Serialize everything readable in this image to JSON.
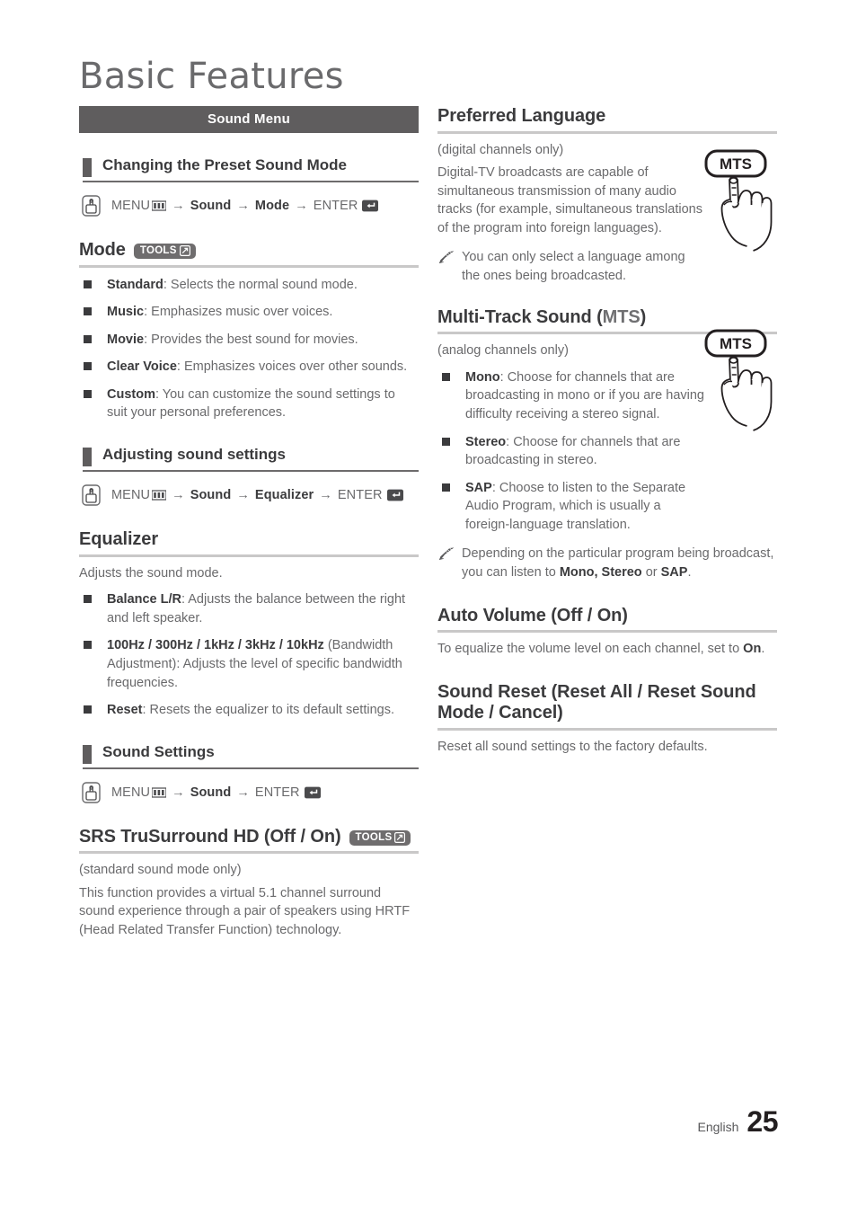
{
  "page": {
    "masthead": "Basic Features",
    "footer_language": "English",
    "footer_page_number": "25",
    "accent_bar_color": "#5f5d5e",
    "rule_color": "#c9c8c8",
    "body_text_color": "#6a6a6c",
    "heading_text_color": "#3b3b3d"
  },
  "left_column": {
    "section_bar": "Sound Menu",
    "sections": [
      {
        "subheading": "Changing the Preset Sound Mode",
        "menu_path": {
          "icon": "press-hand-icon",
          "items": [
            "MENU",
            "Sound",
            "Mode",
            "ENTER"
          ],
          "menu_icon": "menu-bars-icon",
          "enter_icon": "enter-return-icon",
          "arrow": "→"
        },
        "topic": {
          "title": "Mode",
          "badge": "TOOLS",
          "badge_icon": "tools-arrow-icon",
          "bullets": [
            {
              "term": "Standard",
              "desc": ": Selects the normal sound mode."
            },
            {
              "term": "Music",
              "desc": ": Emphasizes music over voices."
            },
            {
              "term": "Movie",
              "desc": ": Provides the best sound for movies."
            },
            {
              "term": "Clear Voice",
              "desc": ": Emphasizes voices over other sounds."
            },
            {
              "term": "Custom",
              "desc": ": You can customize the sound settings to suit your personal preferences."
            }
          ]
        }
      },
      {
        "subheading": "Adjusting sound settings",
        "menu_path": {
          "icon": "press-hand-icon",
          "items": [
            "MENU",
            "Sound",
            "Equalizer",
            "ENTER"
          ],
          "menu_icon": "menu-bars-icon",
          "enter_icon": "enter-return-icon",
          "arrow": "→"
        },
        "topic": {
          "title": "Equalizer",
          "intro": "Adjusts the sound mode.",
          "bullets": [
            {
              "term": "Balance L/R",
              "desc": ": Adjusts the balance between the right and left speaker."
            },
            {
              "term": "100Hz / 300Hz / 1kHz / 3kHz / 10kHz",
              "desc": " (Bandwidth Adjustment): Adjusts the level of specific bandwidth frequencies."
            },
            {
              "term": "Reset",
              "desc": ": Resets the equalizer to its default settings."
            }
          ]
        }
      },
      {
        "subheading": "Sound Settings",
        "menu_path": {
          "icon": "press-hand-icon",
          "items": [
            "MENU",
            "Sound",
            "ENTER"
          ],
          "menu_icon": "menu-bars-icon",
          "enter_icon": "enter-return-icon",
          "arrow": "→"
        },
        "topic": {
          "title": "SRS TruSurround HD (Off / On)",
          "badge": "TOOLS",
          "badge_icon": "tools-arrow-icon",
          "note_line": "(standard sound mode only)",
          "paragraph": "This function provides a virtual 5.1 channel surround sound experience through a pair of speakers using HRTF (Head Related Transfer Function) technology."
        }
      }
    ]
  },
  "right_column": {
    "topics": [
      {
        "title": "Preferred Language",
        "subtitle": "(digital channels only)",
        "paragraph": "Digital-TV broadcasts are capable of simultaneous transmission of many audio tracks (for example, simultaneous translations of the program into foreign languages).",
        "note": "You can only select a language among the ones being broadcasted.",
        "note_icon": "pencil-note-icon",
        "illustration": {
          "icon": "mts-button-press-icon",
          "label": "MTS"
        }
      },
      {
        "title_main": "Multi-Track Sound (",
        "title_light": "MTS",
        "title_end": ")",
        "subtitle": "(analog channels only)",
        "bullets": [
          {
            "term": "Mono",
            "desc": ": Choose for channels that are broadcasting in mono or if you are having difficulty receiving a stereo signal."
          },
          {
            "term": "Stereo",
            "desc": ": Choose for channels that are broadcasting in stereo."
          },
          {
            "term": "SAP",
            "desc": ": Choose to listen to the Separate Audio Program, which is usually a foreign-language translation."
          }
        ],
        "note_prefix": "Depending on the particular program being broadcast, you can listen to ",
        "note_bold1": "Mono, Stereo",
        "note_mid": " or ",
        "note_bold2": "SAP",
        "note_suffix": ".",
        "note_icon": "pencil-note-icon",
        "illustration": {
          "icon": "mts-button-press-icon",
          "label": "MTS"
        }
      },
      {
        "title": "Auto Volume (Off / On)",
        "paragraph_prefix": "To equalize the volume level on each channel, set to ",
        "paragraph_bold": "On",
        "paragraph_suffix": "."
      },
      {
        "title": "Sound Reset (Reset All / Reset Sound Mode / Cancel)",
        "paragraph": "Reset all sound settings to the factory defaults."
      }
    ]
  }
}
